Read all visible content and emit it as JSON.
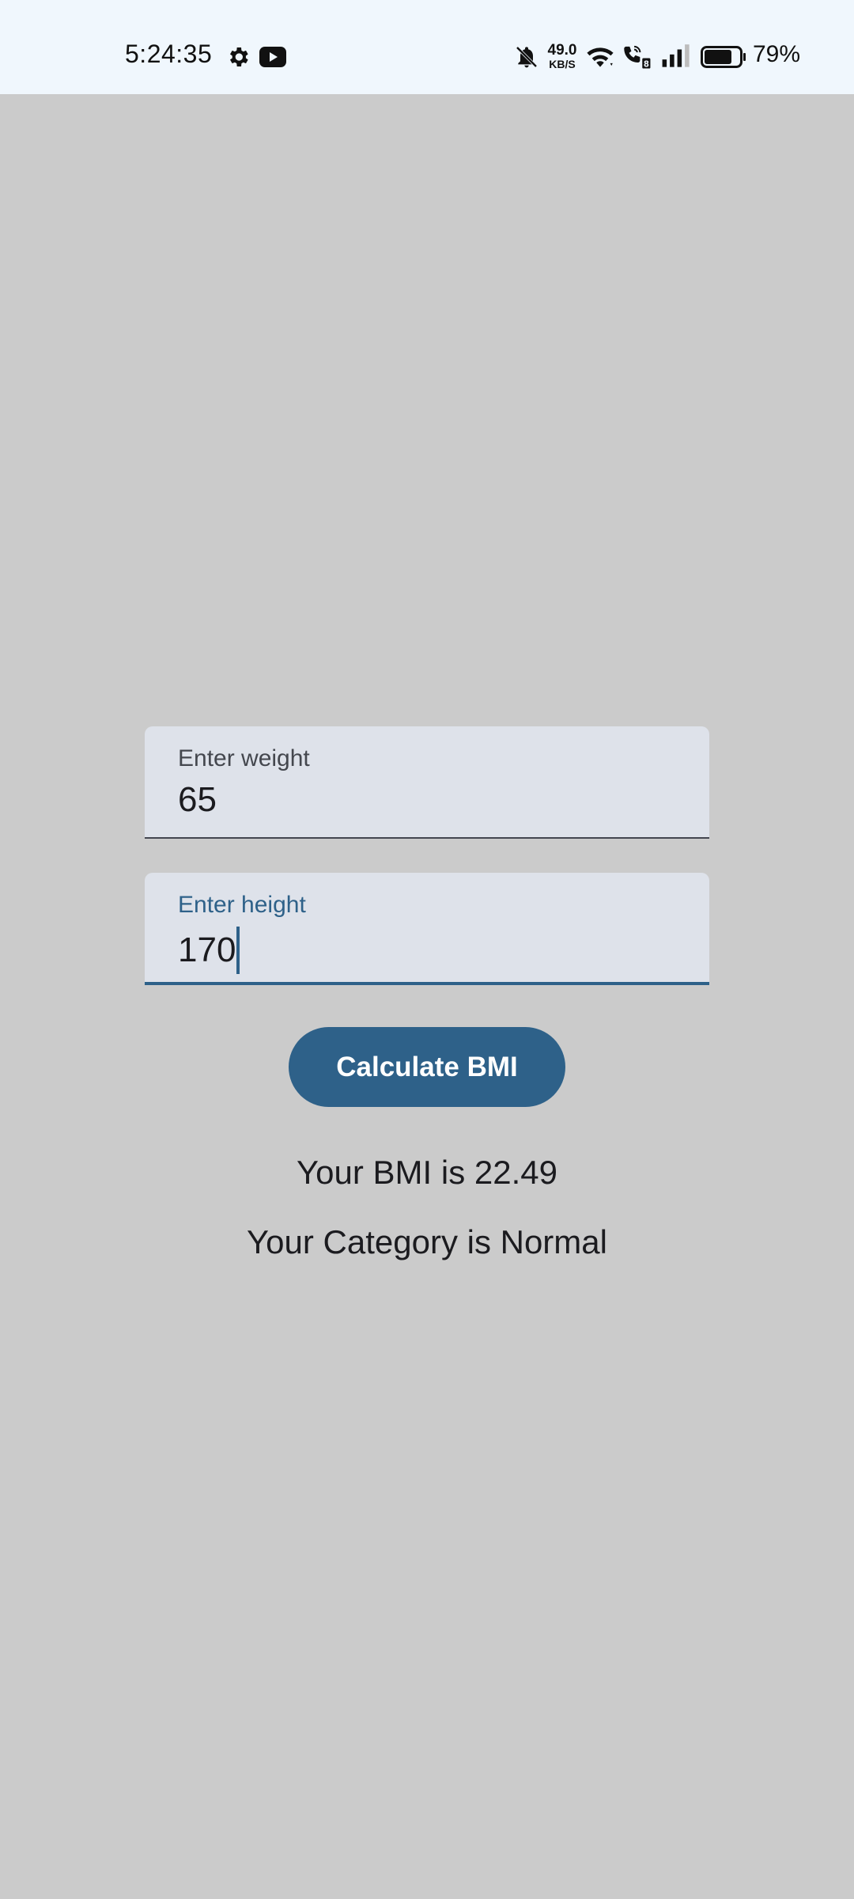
{
  "status_bar": {
    "time": "5:24:35",
    "icons": [
      "settings-icon",
      "youtube-icon",
      "bell-off-icon",
      "wifi-icon",
      "wifi-calling-icon",
      "signal-icon",
      "battery-icon"
    ],
    "net_speed_value": "49.0",
    "net_speed_unit": "KB/S",
    "battery_percent": "79%",
    "battery_level": 0.79
  },
  "form": {
    "weight": {
      "label": "Enter weight",
      "value": "65"
    },
    "height": {
      "label": "Enter height",
      "value": "170"
    },
    "calculate_label": "Calculate BMI"
  },
  "results": {
    "bmi_text": "Your BMI is 22.49",
    "category_text": "Your Category is Normal"
  },
  "colors": {
    "background": "#cbcbcb",
    "status_bar": "#f0f7fd",
    "field_bg": "#dee2ea",
    "primary": "#2e6189",
    "text": "#1b1b1f"
  }
}
